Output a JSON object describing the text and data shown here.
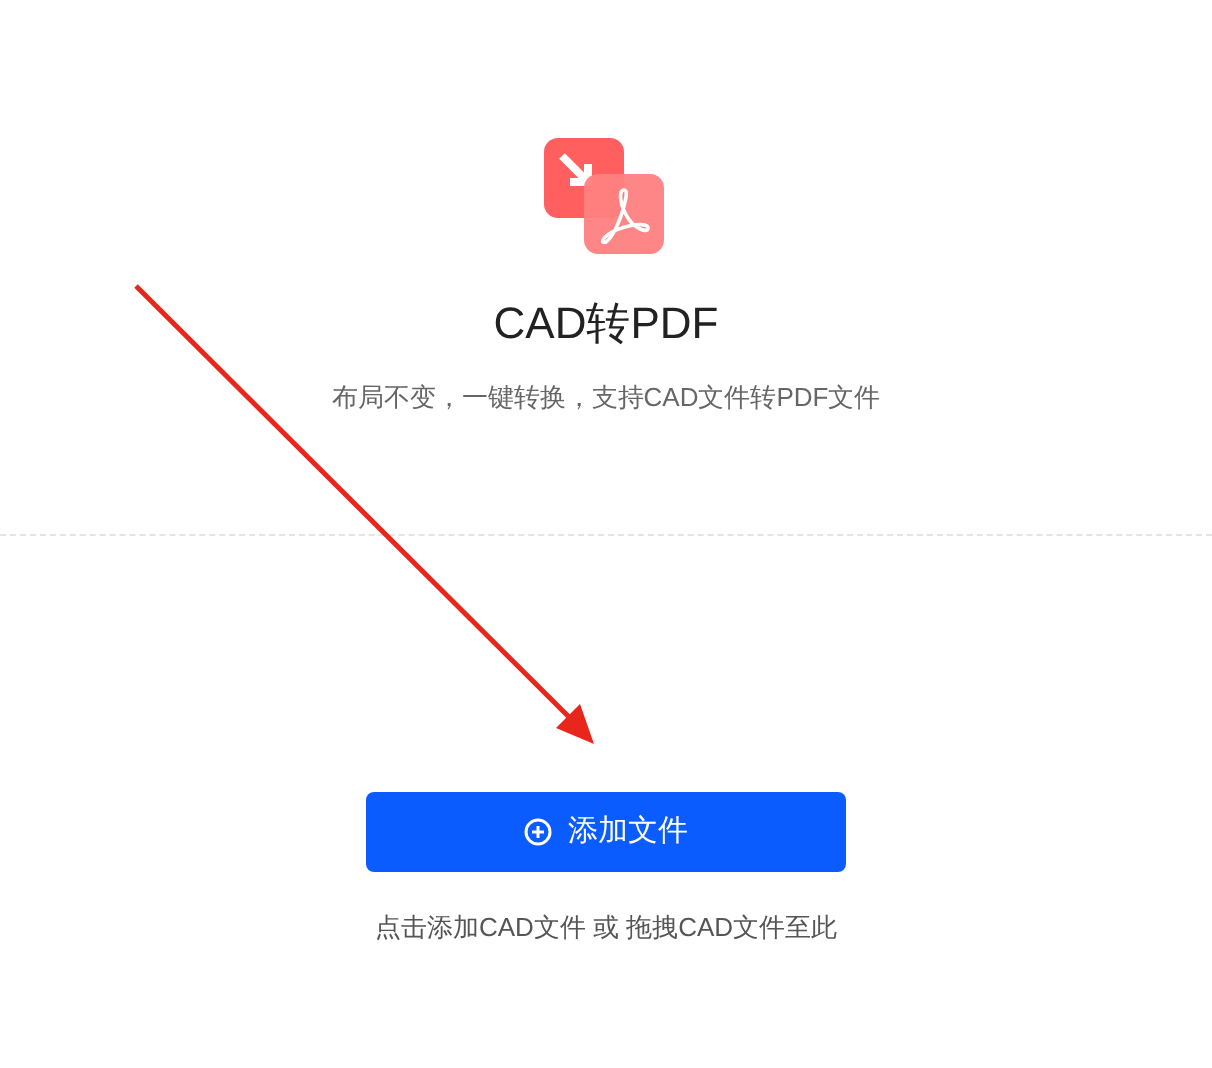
{
  "tool": {
    "title": "CAD转PDF",
    "subtitle": "布局不变，一键转换，支持CAD文件转PDF文件"
  },
  "upload": {
    "button": "添加文件",
    "hint": "点击添加CAD文件 或 拖拽CAD文件至此"
  }
}
